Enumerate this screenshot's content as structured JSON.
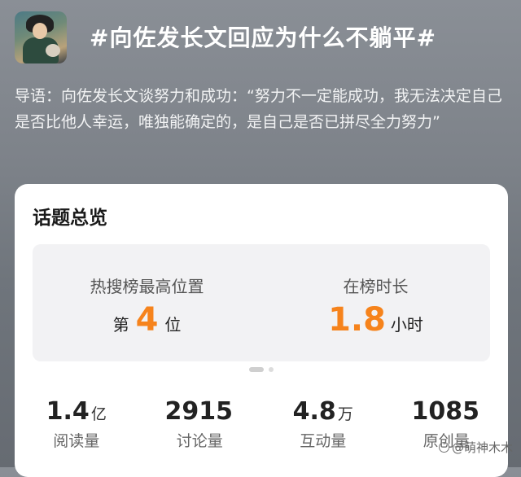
{
  "header": {
    "topic_title": "#向佐发长文回应为什么不躺平#",
    "intro": "导语：向佐发长文谈努力和成功：“努力不一定能成功，我无法决定自己是否比他人幸运，唯独能确定的，是自己是否已拼尽全力努力”",
    "avatar_icon": "profile-photo"
  },
  "overview": {
    "title": "话题总览",
    "hot_rank": {
      "label": "热搜榜最高位置",
      "prefix": "第",
      "value": "4",
      "suffix": "位"
    },
    "duration": {
      "label": "在榜时长",
      "value": "1.8",
      "unit": "小时"
    },
    "accent_color": "#f6831c"
  },
  "metrics": [
    {
      "value": "1.4",
      "unit": "亿",
      "label": "阅读量"
    },
    {
      "value": "2915",
      "unit": "",
      "label": "讨论量"
    },
    {
      "value": "4.8",
      "unit": "万",
      "label": "互动量"
    },
    {
      "value": "1085",
      "unit": "",
      "label": "原创量"
    }
  ],
  "watermark": "@萌神木木"
}
